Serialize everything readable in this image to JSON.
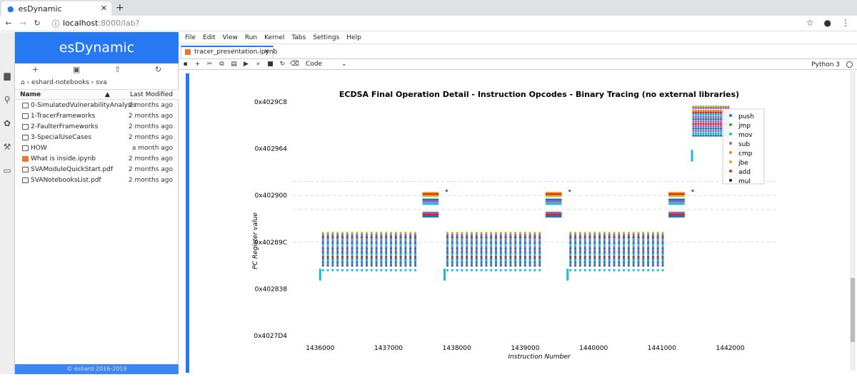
{
  "browser": {
    "tab_title": "esDynamic",
    "url_host": "localhost",
    "url_path": ":8000/lab?",
    "new_tab": "+",
    "tab_close": "✕"
  },
  "sidebar": {
    "title": "esDynamic",
    "breadcrumb": "› eshard-notebooks › sva",
    "col_name": "Name",
    "col_modified": "Last Modified",
    "files": [
      {
        "name": "0-SimulatedVulnerabilityAnalysis",
        "modified": "2 months ago",
        "type": "folder"
      },
      {
        "name": "1-TracerFrameworks",
        "modified": "2 months ago",
        "type": "folder"
      },
      {
        "name": "2-FaulterFrameworks",
        "modified": "2 months ago",
        "type": "folder"
      },
      {
        "name": "3-SpecialUseCases",
        "modified": "2 months ago",
        "type": "folder"
      },
      {
        "name": "HOW",
        "modified": "a month ago",
        "type": "folder"
      },
      {
        "name": "What is inside.ipynb",
        "modified": "2 months ago",
        "type": "notebook"
      },
      {
        "name": "SVAModuleQuickStart.pdf",
        "modified": "2 months ago",
        "type": "file"
      },
      {
        "name": "SVANotebooksList.pdf",
        "modified": "2 months ago",
        "type": "file"
      }
    ],
    "footer": "© eshard 2016-2019"
  },
  "menubar": [
    "File",
    "Edit",
    "View",
    "Run",
    "Kernel",
    "Tabs",
    "Settings",
    "Help"
  ],
  "doc_tab": {
    "title": "tracer_presentation.ipynb"
  },
  "toolbar": {
    "cell_type": "Code",
    "kernel": "Python 3"
  },
  "chart_data": {
    "type": "scatter",
    "title": "ECDSA Final Operation Detail - Instruction Opcodes - Binary Tracing (no external libraries)",
    "xlabel": "Instruction Number",
    "ylabel": "PC Register value",
    "xticks": [
      "1436000",
      "1437000",
      "1438000",
      "1439000",
      "1440000",
      "1441000",
      "1442000"
    ],
    "yticks": [
      "0x4027D4",
      "0x402838",
      "0x40289C",
      "0x402900",
      "0x402964",
      "0x4029C8"
    ],
    "xlim": [
      1435600,
      1442600
    ],
    "ylim": [
      4204500,
      4205000
    ],
    "ytick_values": [
      4204500,
      4204600,
      4204700,
      4204800,
      4204900,
      4205000
    ],
    "grid": "horizontal dashed",
    "legend_position": "upper right",
    "series": [
      {
        "name": "push",
        "color": "#1f77b4"
      },
      {
        "name": "jmp",
        "color": "#2ca02c"
      },
      {
        "name": "mov",
        "color": "#17becf"
      },
      {
        "name": "sub",
        "color": "#9467bd"
      },
      {
        "name": "cmp",
        "color": "#ff7f0e"
      },
      {
        "name": "jbe",
        "color": "#bcbd22"
      },
      {
        "name": "add",
        "color": "#d62728"
      },
      {
        "name": "mul",
        "color": "#222222"
      }
    ],
    "segments": [
      {
        "kind": "loop",
        "x_start": 1436000,
        "x_end": 1437450,
        "y_low": 4204640,
        "y_high": 4204720
      },
      {
        "kind": "block",
        "x_start": 1437470,
        "x_end": 1437850,
        "y_low": 4204755,
        "y_high": 4204805
      },
      {
        "kind": "loop",
        "x_start": 1437820,
        "x_end": 1439250,
        "y_low": 4204640,
        "y_high": 4204720
      },
      {
        "kind": "block",
        "x_start": 1439270,
        "x_end": 1439650,
        "y_low": 4204755,
        "y_high": 4204805
      },
      {
        "kind": "loop",
        "x_start": 1439620,
        "x_end": 1441050,
        "y_low": 4204640,
        "y_high": 4204720
      },
      {
        "kind": "block",
        "x_start": 1441070,
        "x_end": 1441450,
        "y_low": 4204755,
        "y_high": 4204805
      },
      {
        "kind": "tail",
        "x_start": 1441430,
        "x_end": 1442000,
        "y_low": 4204900,
        "y_high": 4204990
      }
    ]
  }
}
